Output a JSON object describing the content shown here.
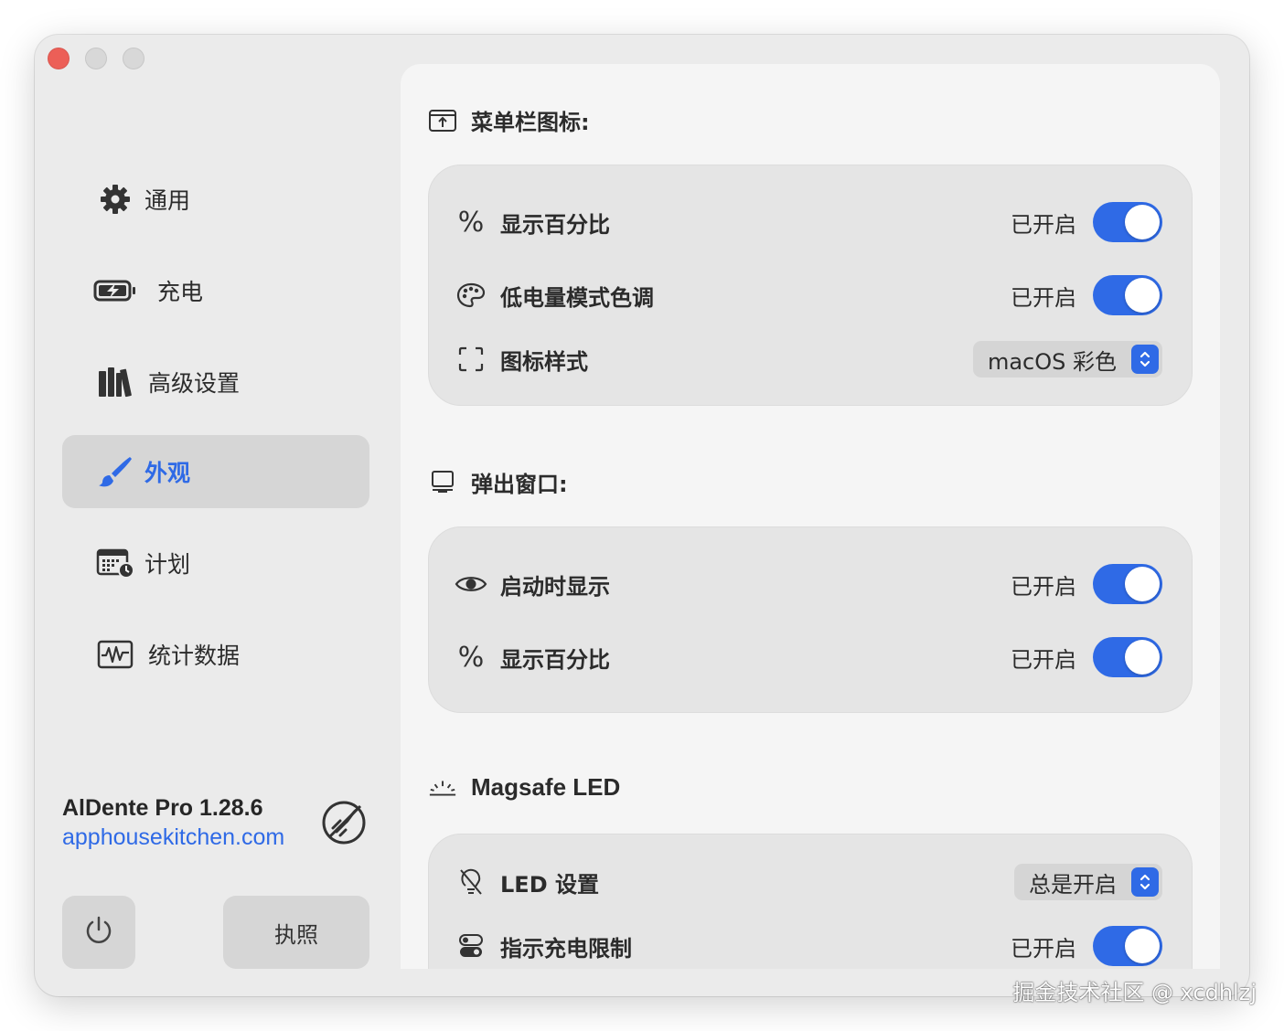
{
  "sidebar": {
    "items": [
      {
        "label": "通用",
        "icon": "gear-icon"
      },
      {
        "label": "充电",
        "icon": "battery-charging-icon"
      },
      {
        "label": "高级设置",
        "icon": "books-icon"
      },
      {
        "label": "外观",
        "icon": "paintbrush-icon",
        "active": true
      },
      {
        "label": "计划",
        "icon": "calendar-clock-icon"
      },
      {
        "label": "统计数据",
        "icon": "waveform-icon"
      }
    ],
    "app_name": "AlDente Pro 1.28.6",
    "app_link": "apphousekitchen.com",
    "license_button": "执照",
    "power_icon": "power-icon"
  },
  "sections": {
    "menubar": {
      "title": "菜单栏图标:",
      "rows": [
        {
          "label": "显示百分比",
          "status": "已开启",
          "on": true
        },
        {
          "label": "低电量模式色调",
          "status": "已开启",
          "on": true
        },
        {
          "label": "图标样式",
          "select": "macOS 彩色"
        }
      ]
    },
    "popup": {
      "title": "弹出窗口:",
      "rows": [
        {
          "label": "启动时显示",
          "status": "已开启",
          "on": true
        },
        {
          "label": "显示百分比",
          "status": "已开启",
          "on": true
        }
      ]
    },
    "magsafe": {
      "title": "Magsafe LED",
      "rows": [
        {
          "label": "LED 设置",
          "select": "总是开启"
        },
        {
          "label": "指示充电限制",
          "status": "已开启",
          "on": true
        }
      ]
    }
  },
  "colors": {
    "accent": "#2f6ae6",
    "close": "#ec5f57"
  },
  "watermark": "掘金技术社区 @ xcdhlzj"
}
